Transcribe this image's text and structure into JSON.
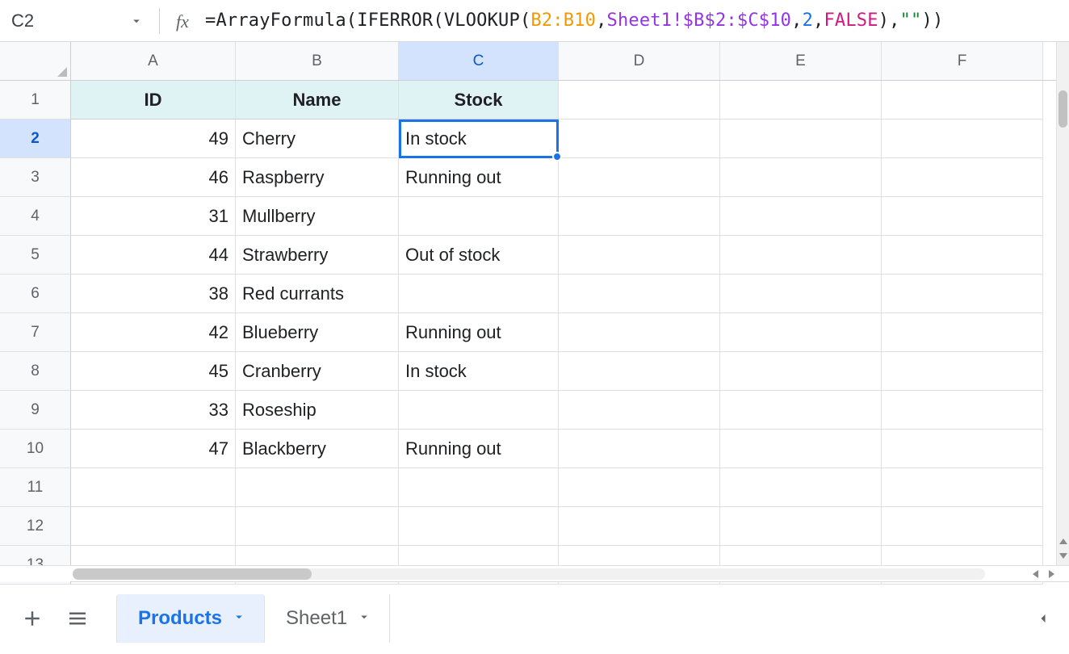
{
  "namebox": {
    "value": "C2"
  },
  "fx_label": "fx",
  "formula": {
    "raw": "=ArrayFormula(IFERROR(VLOOKUP(B2:B10,Sheet1!$B$2:$C$10,2,FALSE),\"\"))",
    "tokens": {
      "af": "ArrayFormula",
      "ife": "IFERROR",
      "vl": "VLOOKUP",
      "rng": "B2:B10",
      "ref": "Sheet1!$B$2:$C$10",
      "idx": "2",
      "kw": "FALSE",
      "str": "\"\""
    }
  },
  "columns": [
    "A",
    "B",
    "C",
    "D",
    "E",
    "F"
  ],
  "active_column_index": 2,
  "rows_visible": 13,
  "active_row": 2,
  "headers": {
    "A": "ID",
    "B": "Name",
    "C": "Stock"
  },
  "data_rows": [
    {
      "id": "49",
      "name": "Cherry",
      "stock": "In stock"
    },
    {
      "id": "46",
      "name": "Raspberry",
      "stock": "Running out"
    },
    {
      "id": "31",
      "name": "Mullberry",
      "stock": ""
    },
    {
      "id": "44",
      "name": "Strawberry",
      "stock": "Out of stock"
    },
    {
      "id": "38",
      "name": "Red currants",
      "stock": ""
    },
    {
      "id": "42",
      "name": "Blueberry",
      "stock": "Running out"
    },
    {
      "id": "45",
      "name": "Cranberry",
      "stock": "In stock"
    },
    {
      "id": "33",
      "name": "Roseship",
      "stock": ""
    },
    {
      "id": "47",
      "name": "Blackberry",
      "stock": "Running out"
    }
  ],
  "tabs": [
    {
      "label": "Products",
      "active": true
    },
    {
      "label": "Sheet1",
      "active": false
    }
  ],
  "chart_data": {
    "type": "table",
    "columns": [
      "ID",
      "Name",
      "Stock"
    ],
    "rows": [
      [
        49,
        "Cherry",
        "In stock"
      ],
      [
        46,
        "Raspberry",
        "Running out"
      ],
      [
        31,
        "Mullberry",
        ""
      ],
      [
        44,
        "Strawberry",
        "Out of stock"
      ],
      [
        38,
        "Red currants",
        ""
      ],
      [
        42,
        "Blueberry",
        "Running out"
      ],
      [
        45,
        "Cranberry",
        "In stock"
      ],
      [
        33,
        "Roseship",
        ""
      ],
      [
        47,
        "Blackberry",
        "Running out"
      ]
    ]
  }
}
